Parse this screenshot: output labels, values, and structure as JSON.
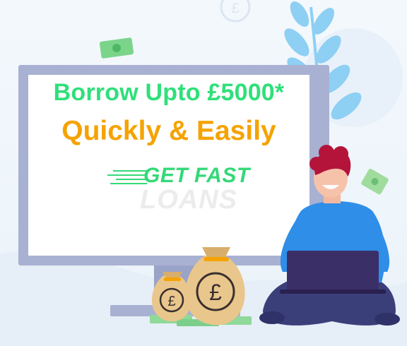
{
  "banner": {
    "headline": "Borrow Upto £5000*",
    "subline": "Quickly & Easily"
  },
  "logo": {
    "line1": "GET FAST",
    "line2": "LOANS"
  },
  "icons": {
    "coin": "pound-coin-icon",
    "bag": "money-bag-icon",
    "note": "banknote-icon",
    "plant": "leaf-branch-icon"
  },
  "colors": {
    "headline_green": "#2fe07a",
    "subline_orange": "#f5a300",
    "monitor_frame": "#a9b1d2",
    "leaf_blue": "#8ecff4",
    "shirt_blue": "#2f8ee8",
    "pants_navy": "#3a3f7a",
    "laptop": "#3b2f68",
    "hair": "#b4143a",
    "bag_tan": "#e9c68c"
  }
}
